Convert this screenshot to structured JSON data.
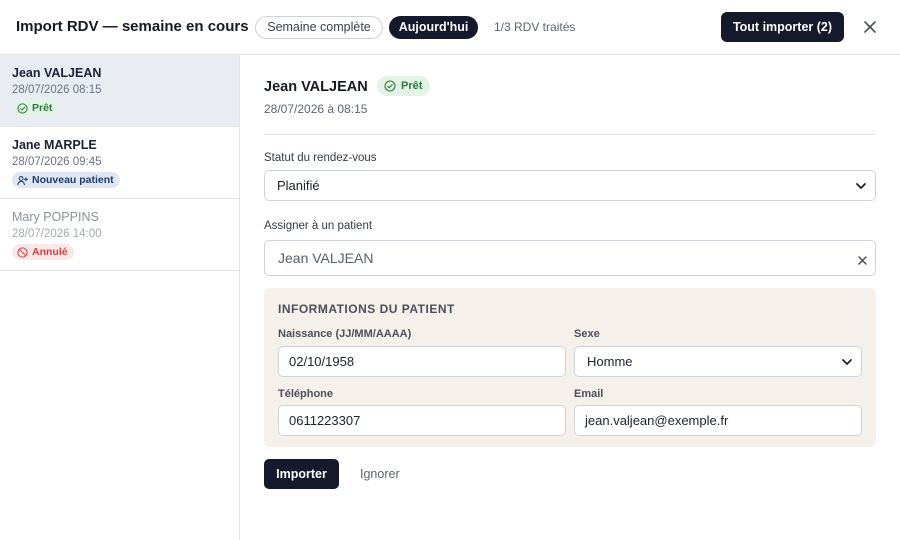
{
  "header": {
    "title": "Import RDV — semaine en cours",
    "filter_week": "Semaine complète",
    "filter_today": "Aujourd'hui",
    "processed": "1/3 RDV traités",
    "import_all": "Tout importer (2)"
  },
  "sidebar": {
    "items": [
      {
        "name": "Jean VALJEAN",
        "date": "28/07/2026 08:15",
        "badge": "Prêt",
        "status": "ready"
      },
      {
        "name": "Jane MARPLE",
        "date": "28/07/2026 09:45",
        "badge": "Nouveau patient",
        "status": "new"
      },
      {
        "name": "Mary POPPINS",
        "date": "28/07/2026 14:00",
        "badge": "Annulé",
        "status": "cancelled"
      }
    ]
  },
  "detail": {
    "name": "Jean VALJEAN",
    "badge": "Prêt",
    "date": "28/07/2026 à 08:15",
    "status_label": "Statut du rendez-vous",
    "status_value": "Planifié",
    "assign_label": "Assigner à un patient",
    "assign_value": "Jean VALJEAN",
    "info": {
      "title": "INFORMATIONS DU PATIENT",
      "birth_label": "Naissance (JJ/MM/AAAA)",
      "birth_value": "02/10/1958",
      "sex_label": "Sexe",
      "sex_value": "Homme",
      "phone_label": "Téléphone",
      "phone_value": "0611223307",
      "email_label": "Email",
      "email_value": "jean.valjean@exemple.fr"
    },
    "import_button": "Importer",
    "ignore_button": "Ignorer"
  },
  "colors": {
    "primary": "#141a2b",
    "ready_bg": "#e3f3e6",
    "ready_fg": "#2b7a3d",
    "new_bg": "#dfe7f3",
    "cancel_bg": "#fbe7e7",
    "cancel_fg": "#d24545",
    "panel_bg": "#f6f0ea"
  }
}
